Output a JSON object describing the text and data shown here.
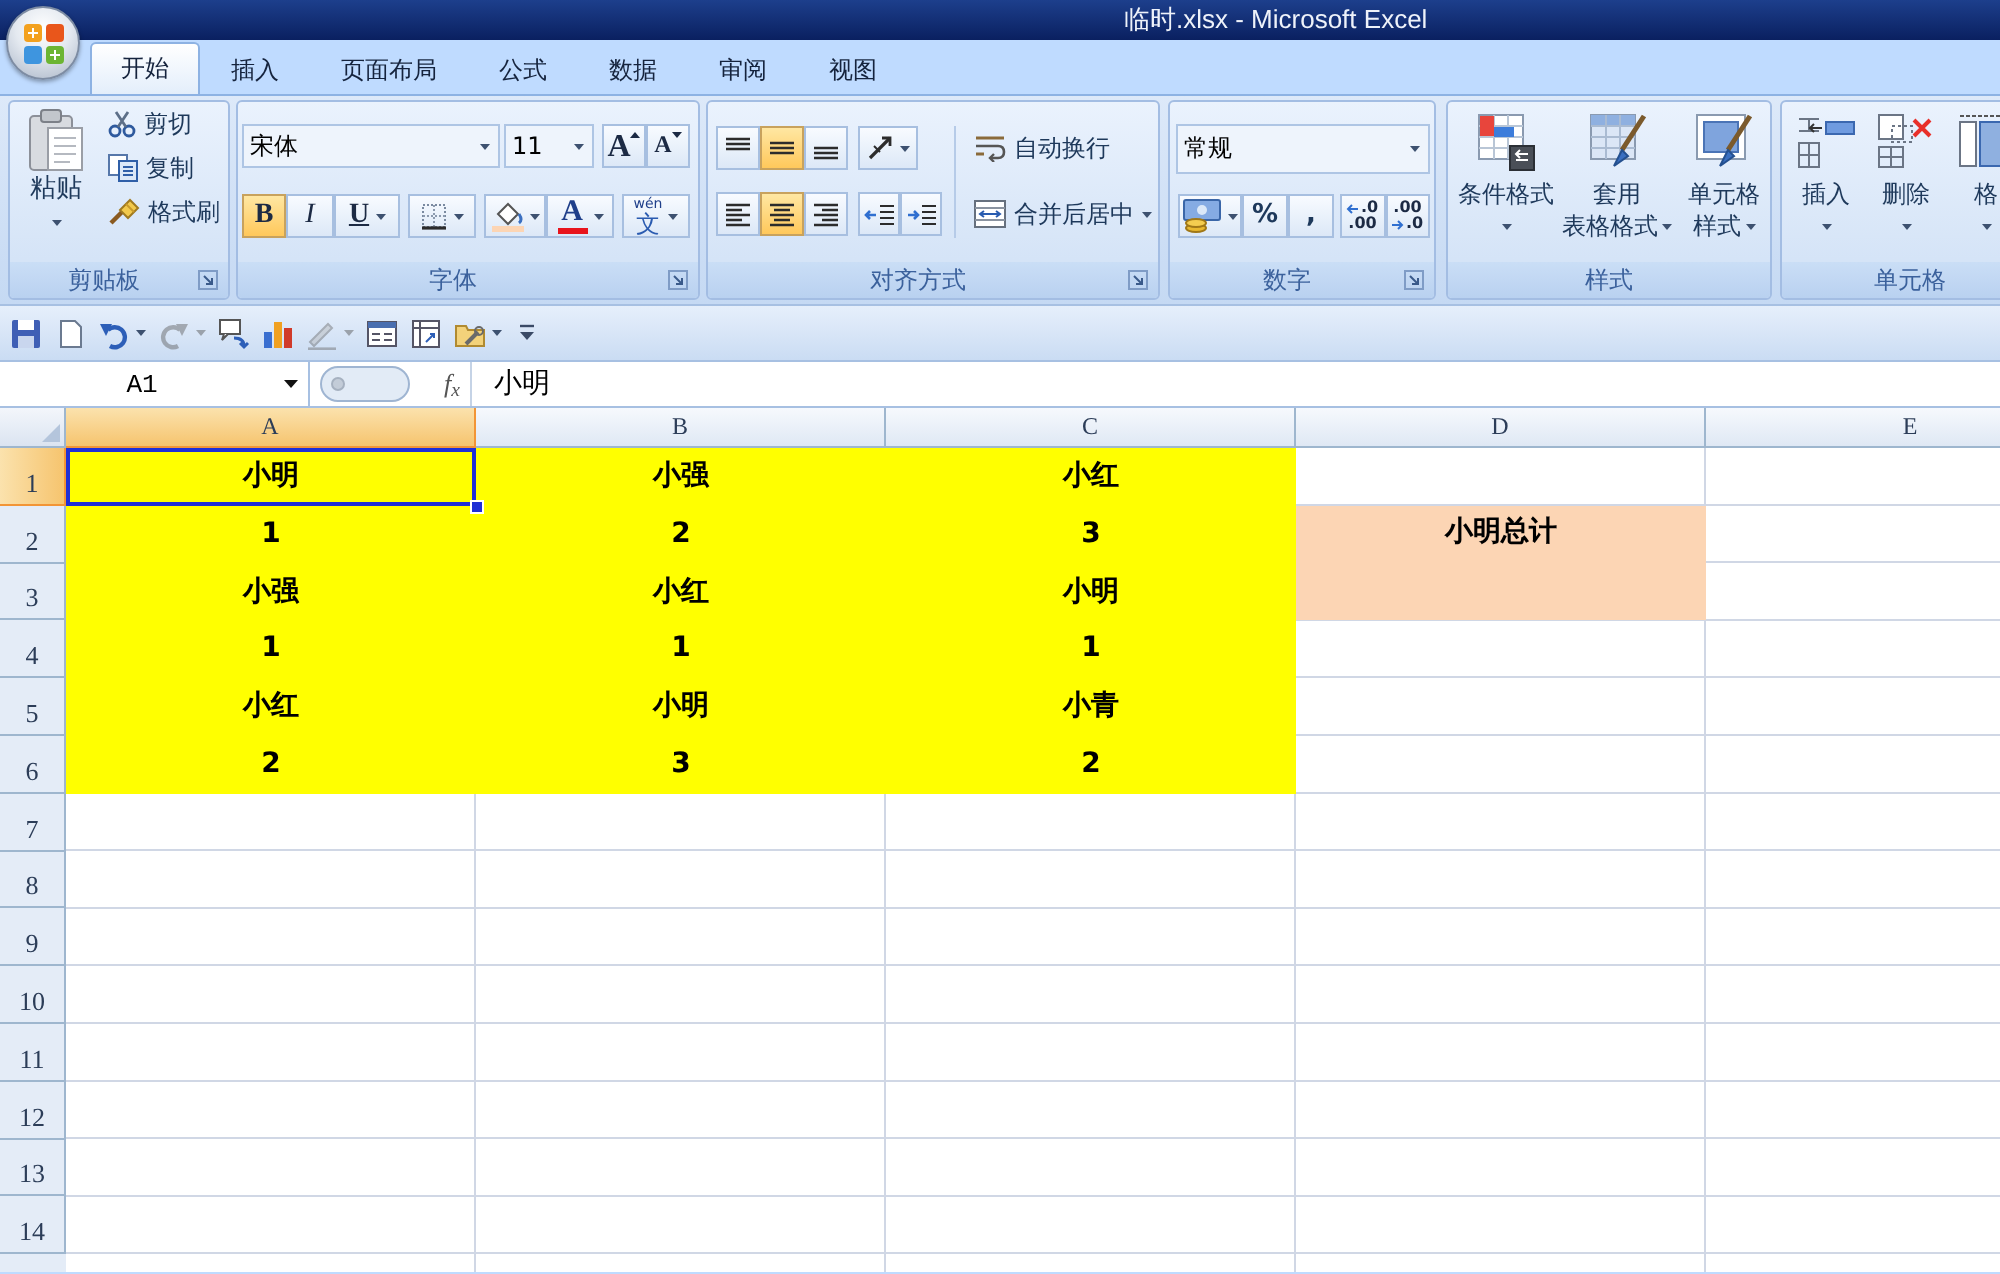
{
  "window": {
    "title": "临时.xlsx - Microsoft Excel"
  },
  "tabs": [
    {
      "label": "开始",
      "selected": true
    },
    {
      "label": "插入",
      "selected": false
    },
    {
      "label": "页面布局",
      "selected": false
    },
    {
      "label": "公式",
      "selected": false
    },
    {
      "label": "数据",
      "selected": false
    },
    {
      "label": "审阅",
      "selected": false
    },
    {
      "label": "视图",
      "selected": false
    }
  ],
  "ribbon": {
    "clipboard": {
      "label": "剪贴板",
      "launcher": true,
      "paste": "粘贴",
      "commands": [
        {
          "kind": "cut",
          "label": "剪切"
        },
        {
          "kind": "copy",
          "label": "复制"
        },
        {
          "kind": "format_painter",
          "label": "格式刷"
        }
      ]
    },
    "font": {
      "label": "字体",
      "launcher": true,
      "font_name": "宋体",
      "font_size": "11",
      "grow": "A",
      "shrink": "A",
      "styles": [
        {
          "kind": "bold",
          "label": "B",
          "on": true
        },
        {
          "kind": "italic",
          "label": "I",
          "on": false
        },
        {
          "kind": "underline",
          "label": "U",
          "on": false
        }
      ],
      "font_color": "A",
      "phonetic": {
        "ruby": "wén",
        "label": "文"
      }
    },
    "alignment": {
      "label": "对齐方式",
      "launcher": true,
      "vertical": [
        {
          "kind": "top",
          "selected": false
        },
        {
          "kind": "middle",
          "selected": true
        },
        {
          "kind": "bottom",
          "selected": false
        }
      ],
      "horizontal": [
        {
          "kind": "left",
          "selected": false
        },
        {
          "kind": "center",
          "selected": true
        },
        {
          "kind": "right",
          "selected": false
        }
      ],
      "wrap_text": "自动换行",
      "merge_center": "合并后居中"
    },
    "number": {
      "label": "数字",
      "launcher": true,
      "format": "常规",
      "percent": "%",
      "comma": ",",
      "increase_decimal": [
        ".0",
        ".00"
      ],
      "decrease_decimal": [
        ".00",
        ".0"
      ]
    },
    "styles": {
      "label": "样式",
      "launcher": false,
      "commands": [
        {
          "kind": "conditional_format",
          "lines": [
            "条件格式"
          ]
        },
        {
          "kind": "table_format",
          "lines": [
            "套用",
            "表格格式"
          ]
        },
        {
          "kind": "cell_styles",
          "lines": [
            "单元格",
            "样式"
          ]
        }
      ]
    },
    "cells": {
      "label": "单元格",
      "launcher": false,
      "commands": [
        {
          "kind": "insert",
          "lines": [
            "插入"
          ]
        },
        {
          "kind": "delete",
          "lines": [
            "删除"
          ]
        },
        {
          "kind": "format",
          "lines": [
            "格"
          ]
        }
      ]
    }
  },
  "quick_access": [
    {
      "kind": "save",
      "disabled": false,
      "dropdown": false
    },
    {
      "kind": "new",
      "disabled": false,
      "dropdown": false
    },
    {
      "kind": "undo",
      "disabled": false,
      "dropdown": true
    },
    {
      "kind": "redo",
      "disabled": true,
      "dropdown": true
    },
    {
      "kind": "comment",
      "disabled": false,
      "dropdown": false
    },
    {
      "kind": "chart",
      "disabled": false,
      "dropdown": false
    },
    {
      "kind": "draw",
      "disabled": true,
      "dropdown": true
    },
    {
      "kind": "form",
      "disabled": false,
      "dropdown": false
    },
    {
      "kind": "pivot",
      "disabled": false,
      "dropdown": false
    },
    {
      "kind": "tools",
      "disabled": false,
      "dropdown": true
    },
    {
      "kind": "customize",
      "disabled": false,
      "dropdown": false
    }
  ],
  "formula_bar": {
    "name_box": "A1",
    "function_label": "f$_{x}$",
    "content": "小明"
  },
  "sheet": {
    "columns": [
      {
        "label": "A",
        "selected": true
      },
      {
        "label": "B",
        "selected": false
      },
      {
        "label": "C",
        "selected": false
      },
      {
        "label": "D",
        "selected": false
      },
      {
        "label": "E",
        "selected": false
      }
    ],
    "rows": [
      {
        "number": "1",
        "selected": true,
        "cells": [
          {
            "text": "小明",
            "color": "#ffff00",
            "kind": "single",
            "selected": true
          },
          {
            "text": "小强",
            "color": "#ffff00",
            "kind": "single",
            "selected": false
          },
          {
            "text": "小红",
            "color": "#ffff00",
            "kind": "single",
            "selected": false
          }
        ]
      },
      {
        "number": "2",
        "selected": false,
        "cells": [
          {
            "text": "1",
            "color": "#ffff00",
            "kind": "single",
            "selected": false
          },
          {
            "text": "2",
            "color": "#ffff00",
            "kind": "single",
            "selected": false
          },
          {
            "text": "3",
            "color": "#ffff00",
            "kind": "single",
            "selected": false
          },
          {
            "text": "小明总计",
            "color": "#fcd5b4",
            "kind": "merged",
            "selected": false
          }
        ]
      },
      {
        "number": "3",
        "selected": false,
        "cells": [
          {
            "text": "小强",
            "color": "#ffff00",
            "kind": "single",
            "selected": false
          },
          {
            "text": "小红",
            "color": "#ffff00",
            "kind": "single",
            "selected": false
          },
          {
            "text": "小明",
            "color": "#ffff00",
            "kind": "single",
            "selected": false
          }
        ]
      },
      {
        "number": "4",
        "selected": false,
        "cells": [
          {
            "text": "1",
            "color": "#ffff00",
            "kind": "single",
            "selected": false
          },
          {
            "text": "1",
            "color": "#ffff00",
            "kind": "single",
            "selected": false
          },
          {
            "text": "1",
            "color": "#ffff00",
            "kind": "single",
            "selected": false
          }
        ]
      },
      {
        "number": "5",
        "selected": false,
        "cells": [
          {
            "text": "小红",
            "color": "#ffff00",
            "kind": "single",
            "selected": false
          },
          {
            "text": "小明",
            "color": "#ffff00",
            "kind": "single",
            "selected": false
          },
          {
            "text": "小青",
            "color": "#ffff00",
            "kind": "single",
            "selected": false
          }
        ]
      },
      {
        "number": "6",
        "selected": false,
        "cells": [
          {
            "text": "2",
            "color": "#ffff00",
            "kind": "single",
            "selected": false
          },
          {
            "text": "3",
            "color": "#ffff00",
            "kind": "single",
            "selected": false
          },
          {
            "text": "2",
            "color": "#ffff00",
            "kind": "single",
            "selected": false
          }
        ]
      },
      {
        "number": "7",
        "selected": false
      },
      {
        "number": "8",
        "selected": false
      },
      {
        "number": "9",
        "selected": false
      },
      {
        "number": "10",
        "selected": false
      },
      {
        "number": "11",
        "selected": false
      },
      {
        "number": "12",
        "selected": false
      },
      {
        "number": "13",
        "selected": false
      },
      {
        "number": "14",
        "selected": false
      }
    ]
  }
}
